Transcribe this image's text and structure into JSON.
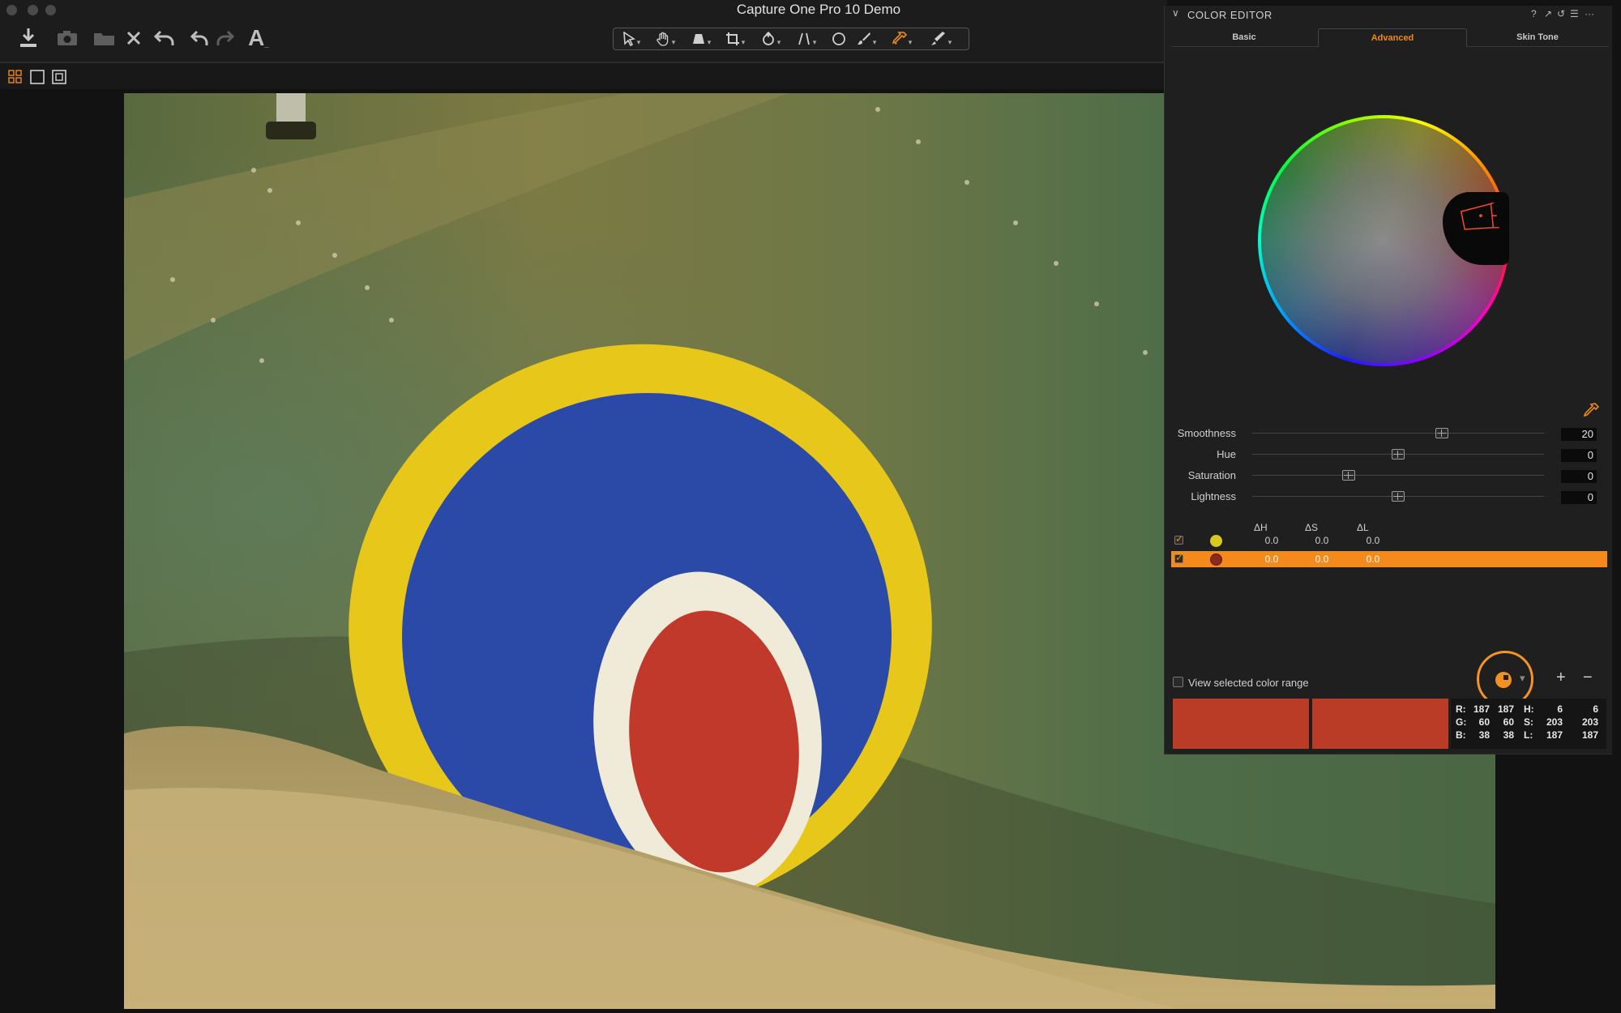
{
  "window": {
    "title": "Capture One Pro 10 Demo"
  },
  "toolbar": {
    "left_icons": [
      "import-icon",
      "camera-icon",
      "folder-icon",
      "delete-icon",
      "undo-history-icon",
      "undo-icon",
      "redo-icon",
      "text-icon"
    ],
    "tools": [
      "cursor-tool-icon",
      "pan-tool-icon",
      "keystone-tool-icon",
      "crop-tool-icon",
      "rotate-tool-icon",
      "straighten-tool-icon",
      "spot-removal-tool-icon",
      "brush-tool-icon",
      "color-picker-tool-icon",
      "annotate-tool-icon"
    ]
  },
  "viewbar": {
    "icons": [
      "grid-view-icon",
      "single-view-icon",
      "fit-view-icon"
    ]
  },
  "viewer": {
    "description_colors": {
      "olive": "#7b7a45",
      "green": "#4f6e48",
      "yellow": "#e8c816",
      "blue": "#2a48a6",
      "white": "#f0ecdc",
      "red": "#c03a2a",
      "beige": "#b8a06a"
    }
  },
  "panel": {
    "title": "COLOR EDITOR",
    "controls": [
      "?",
      "↗",
      "↺",
      "☰",
      "···"
    ],
    "tabs": [
      {
        "label": "Basic",
        "active": false
      },
      {
        "label": "Advanced",
        "active": true
      },
      {
        "label": "Skin Tone",
        "active": false
      }
    ],
    "sliders": [
      {
        "label": "Smoothness",
        "value": "20",
        "position": 0.65
      },
      {
        "label": "Hue",
        "value": "0",
        "position": 0.5
      },
      {
        "label": "Saturation",
        "value": "0",
        "position": 0.33
      },
      {
        "label": "Lightness",
        "value": "0",
        "position": 0.5
      }
    ],
    "table": {
      "headers": [
        "ΔH",
        "ΔS",
        "ΔL"
      ],
      "rows": [
        {
          "checked": true,
          "color": "#d8c81f",
          "dh": "0.0",
          "ds": "0.0",
          "dl": "0.0",
          "selected": false
        },
        {
          "checked": true,
          "color": "#8a2a1e",
          "dh": "0.0",
          "ds": "0.0",
          "dl": "0.0",
          "selected": true
        }
      ]
    },
    "view_selected": "View selected color range",
    "add_label": "+",
    "remove_label": "−",
    "readout": {
      "R": [
        "187",
        "187"
      ],
      "G": [
        "60",
        "60"
      ],
      "B": [
        "38",
        "38"
      ],
      "H": [
        "6",
        "6"
      ],
      "S": [
        "203",
        "203"
      ],
      "L": [
        "187",
        "187"
      ]
    },
    "accent": "#f58a1c",
    "swatch_color": "#bb3c26"
  }
}
